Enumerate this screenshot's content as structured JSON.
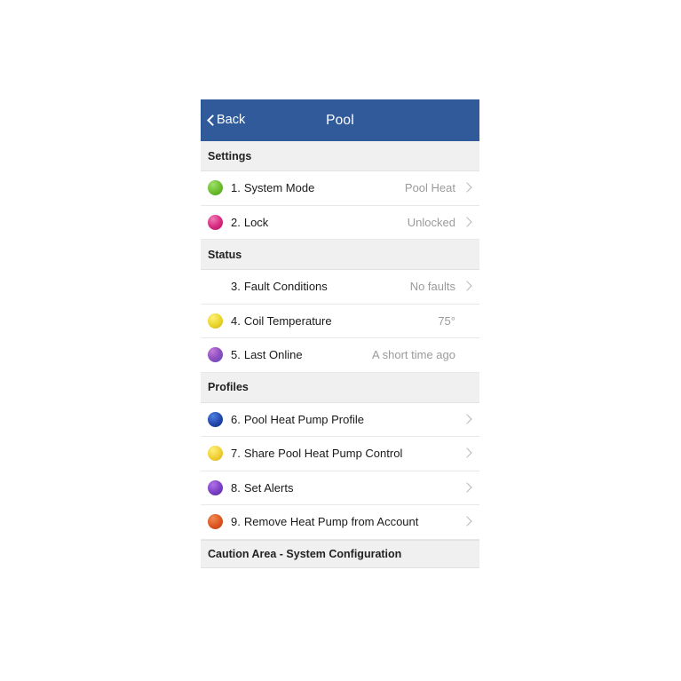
{
  "navbar": {
    "back_label": "Back",
    "title": "Pool",
    "back_icon": "chevron-left-icon",
    "background_color": "#315a9b"
  },
  "sections": [
    {
      "id": "settings",
      "header": "Settings",
      "rows": [
        {
          "num": "1.",
          "label": "System Mode",
          "value": "Pool Heat",
          "arrow": true,
          "icon": "green-fan-mode-icon",
          "icon_color": "#6bbd2e"
        },
        {
          "num": "2.",
          "label": "Lock",
          "value": "Unlocked",
          "arrow": true,
          "icon": "pink-lock-icon",
          "icon_color": "#d6297e"
        }
      ]
    },
    {
      "id": "status",
      "header": "Status",
      "rows": [
        {
          "num": "3.",
          "label": "Fault Conditions",
          "value": "No faults",
          "arrow": true,
          "icon": "red-exclamation-circle-icon",
          "icon_color": "#e01b24"
        },
        {
          "num": "4.",
          "label": "Coil Temperature",
          "value": "75°",
          "arrow": false,
          "icon": "yellow-thermometer-icon",
          "icon_color": "#ead527"
        },
        {
          "num": "5.",
          "label": "Last Online",
          "value": "A short time ago",
          "arrow": false,
          "icon": "purple-satellite-icon",
          "icon_color": "#8f4fc0"
        }
      ]
    },
    {
      "id": "profiles",
      "header": "Profiles",
      "rows": [
        {
          "num": "6.",
          "label": "Pool Heat Pump Profile",
          "value": "",
          "arrow": true,
          "icon": "blue-info-icon",
          "icon_color": "#1f43a8"
        },
        {
          "num": "7.",
          "label": "Share Pool Heat Pump Control",
          "value": "",
          "arrow": true,
          "icon": "yellow-people-group-icon",
          "icon_color": "#f0cf35"
        },
        {
          "num": "8.",
          "label": "Set Alerts",
          "value": "",
          "arrow": true,
          "icon": "purple-bell-icon",
          "icon_color": "#7a3fc4"
        },
        {
          "num": "9.",
          "label": "Remove Heat Pump from Account",
          "value": "",
          "arrow": true,
          "icon": "orange-minus-circle-icon",
          "icon_color": "#dc5520"
        }
      ]
    },
    {
      "id": "caution",
      "header": "Caution Area - System Configuration",
      "rows": []
    }
  ]
}
